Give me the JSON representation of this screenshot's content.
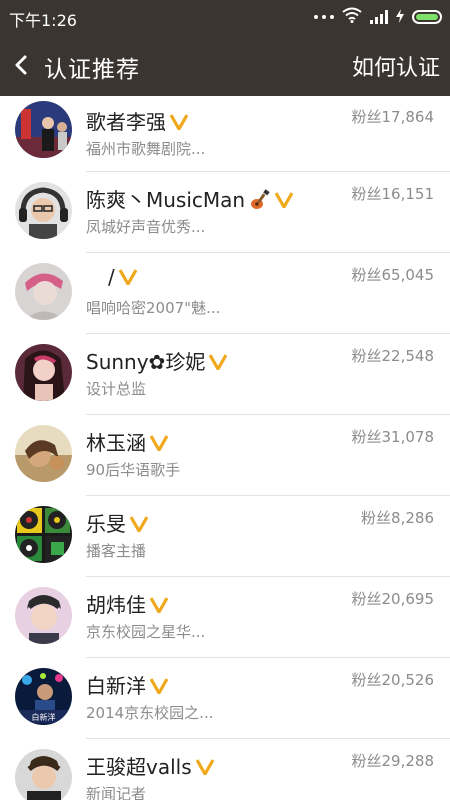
{
  "status_bar": {
    "time": "下午1:26"
  },
  "app_bar": {
    "title": "认证推荐",
    "action": "如何认证"
  },
  "users": [
    {
      "name": "歌者李强",
      "subtitle": "福州市歌舞剧院...",
      "fans": "粉丝17,864",
      "verified": true
    },
    {
      "name": "陈爽丶MusicMan",
      "subtitle": "凤城好声音优秀...",
      "fans": "粉丝16,151",
      "verified": true,
      "emoji": "guitar"
    },
    {
      "name": "/",
      "subtitle": "唱响哈密2007\"魅...",
      "fans": "粉丝65,045",
      "verified": true
    },
    {
      "name": "Sunny✿珍妮",
      "subtitle": "设计总监",
      "fans": "粉丝22,548",
      "verified": true
    },
    {
      "name": "林玉涵",
      "subtitle": "90后华语歌手",
      "fans": "粉丝31,078",
      "verified": true
    },
    {
      "name": "乐旻",
      "subtitle": "播客主播",
      "fans": "粉丝8,286",
      "verified": true
    },
    {
      "name": "胡炜佳",
      "subtitle": "京东校园之星华...",
      "fans": "粉丝20,695",
      "verified": true
    },
    {
      "name": "白新洋",
      "subtitle": "2014京东校园之...",
      "fans": "粉丝20,526",
      "verified": true,
      "avatar_text": "白新洋"
    },
    {
      "name": "王骏超valls",
      "subtitle": "新闻记者",
      "fans": "粉丝29,288",
      "verified": true
    }
  ],
  "colors": {
    "bar": "#3a3531",
    "badge": "#f0a81c",
    "text": "#222222",
    "muted": "#8c8c8c"
  },
  "icons": {
    "back": "chevron-left-icon",
    "verified": "verified-v-icon",
    "wifi": "wifi-icon",
    "signal": "signal-icon",
    "battery": "battery-icon"
  }
}
